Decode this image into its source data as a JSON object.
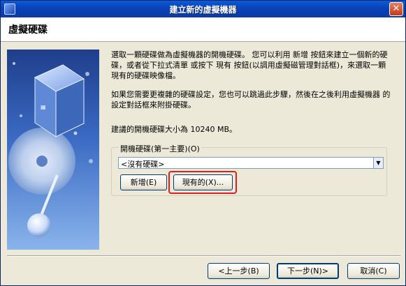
{
  "window": {
    "title": "建立新的虛擬機器",
    "close_glyph": "✕"
  },
  "header": {
    "title": "虛擬硬碟"
  },
  "content": {
    "para1": "選取一顆硬碟做為虛擬機器的開機硬碟。 您可以利用 新增 按鈕來建立一個新的硬碟，或者從下拉式清單 或按下 現有 按鈕(以調用虛擬磁管理對話框)，來選取一顆現有的硬碟映像檔。",
    "para2": "如果您需要更複雜的硬碟設定，您也可以跳過此步驟，然後在之後利用虛擬機器 的設定對話框來附掛硬碟。",
    "para3": "建議的開機硬碟大小為 10240 MB。"
  },
  "boot_disk": {
    "legend": "開機硬碟(第一主要)(O)",
    "selected": "<沒有硬碟>",
    "new_label": "新增(E)",
    "existing_label": "現有的(X)..."
  },
  "footer": {
    "back_label": "<上一步(B)",
    "next_label": "下一步(N)>",
    "cancel_label": "取消(C)"
  },
  "colors": {
    "titlebar": "#0842b8",
    "highlight": "#e02020",
    "dialog_bg": "#ece9d8"
  }
}
